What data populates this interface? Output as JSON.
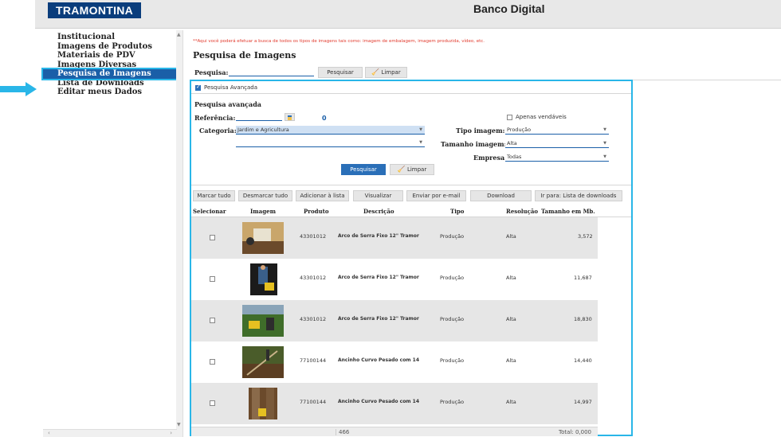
{
  "header": {
    "logo": "TRAMONTINA",
    "title": "Banco Digital"
  },
  "sidebar": {
    "items": [
      {
        "label": "Institucional"
      },
      {
        "label": "Imagens de Produtos"
      },
      {
        "label": "Materiais de PDV"
      },
      {
        "label": "Imagens Diversas"
      },
      {
        "label": "Pesquisa de Imagens",
        "active": true
      },
      {
        "label": "Lista de Downloads"
      },
      {
        "label": "Editar meus Dados"
      }
    ]
  },
  "main": {
    "notice": "**Aqui você poderá efetuar a busca de todos os tipos de imagens tais como: imagem de embalagem, imagem produzida, vídeo, etc.",
    "title": "Pesquisa de Imagens",
    "search_label": "Pesquisa:",
    "search_value": "",
    "search_button": "Pesquisar",
    "clear_button": "Limpar"
  },
  "advanced": {
    "toggle_label": "Pesquisa Avançada",
    "section_title": "Pesquisa avançada",
    "referencia_label": "Referência:",
    "referencia_value": "",
    "result_count": "0",
    "categoria_label": "Categoria:",
    "categoria_value": "Jardim e Agricultura",
    "categoria2_value": "",
    "only_sellable_label": "Apenas vendáveis",
    "tipo_label": "Tipo imagem:",
    "tipo_value": "Produção",
    "tamanho_label": "Tamanho imagem:",
    "tamanho_value": "Alta",
    "empresa_label": "Empresa:",
    "empresa_value": "Todas",
    "search_button": "Pesquisar",
    "clear_button": "Limpar"
  },
  "toolbar": {
    "select_all": "Marcar tudo",
    "deselect_all": "Desmarcar tudo",
    "add_to_list": "Adicionar à lista",
    "view": "Visualizar",
    "send_email": "Enviar por e-mail",
    "download": "Download",
    "goto_downloads": "Ir para: Lista de downloads"
  },
  "grid": {
    "columns": [
      "Selecionar",
      "Imagem",
      "Produto",
      "Descrição",
      "Tipo",
      "Resolução",
      "Tamanho em Mb."
    ],
    "rows": [
      {
        "produto": "43301012",
        "descricao": "Arco de Serra Fixo 12\" Tramor",
        "tipo": "Produção",
        "resolucao": "Alta",
        "tamanho": "3,572"
      },
      {
        "produto": "43301012",
        "descricao": "Arco de Serra Fixo 12\" Tramor",
        "tipo": "Produção",
        "resolucao": "Alta",
        "tamanho": "11,687"
      },
      {
        "produto": "43301012",
        "descricao": "Arco de Serra Fixo 12\" Tramor",
        "tipo": "Produção",
        "resolucao": "Alta",
        "tamanho": "18,830"
      },
      {
        "produto": "77100144",
        "descricao": "Ancinho Curvo Pesado com 14",
        "tipo": "Produção",
        "resolucao": "Alta",
        "tamanho": "14,440"
      },
      {
        "produto": "77100144",
        "descricao": "Ancinho Curvo Pesado com 14",
        "tipo": "Produção",
        "resolucao": "Alta",
        "tamanho": "14,997"
      }
    ],
    "total_count": "466",
    "total_size": "Total: 0,000"
  },
  "colors": {
    "brand": "#0a3d7c",
    "accent": "#2a6fb8",
    "highlight": "#29b6e8",
    "notice": "#e23b2e"
  }
}
